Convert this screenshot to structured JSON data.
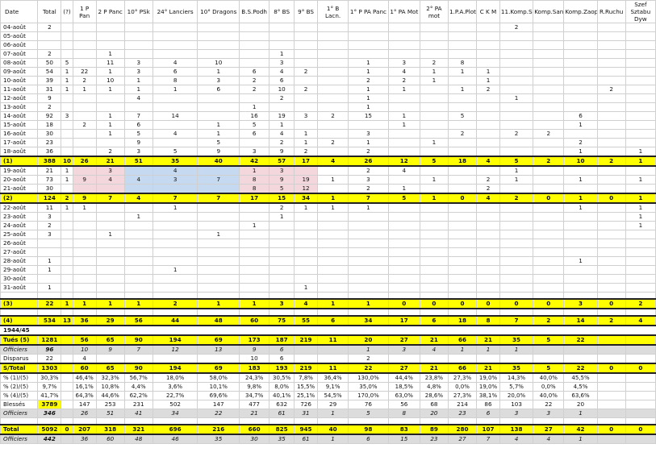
{
  "columns": [
    "Date",
    "Total",
    "(?)",
    "1 P Pan",
    "2 P Panc",
    "10° PSk",
    "24° Lanciers",
    "10° Dragons",
    "B.S.Podh",
    "8° BS",
    "9° BS",
    "1° B Lacn.",
    "1° P PA Panc",
    "1° PA Mot",
    "2° PA mot",
    "1.P.A.Plot.",
    "C K M",
    "11.Komp.Sap",
    "Komp.San",
    "Komp.Zaop.",
    "R.Ruchu",
    "Szef Sztabu Dyw"
  ],
  "rows": [
    {
      "type": "normal",
      "cells": [
        "04-août",
        "2",
        "",
        "",
        "",
        "",
        "",
        "",
        "",
        "",
        "",
        "",
        "",
        "",
        "",
        "",
        "",
        "2",
        "",
        "",
        "",
        ""
      ]
    },
    {
      "type": "normal",
      "cells": [
        "05-août",
        "",
        "",
        "",
        "",
        "",
        "",
        "",
        "",
        "",
        "",
        "",
        "",
        "",
        "",
        "",
        "",
        "",
        "",
        "",
        "",
        ""
      ]
    },
    {
      "type": "normal",
      "cells": [
        "06-août",
        "",
        "",
        "",
        "",
        "",
        "",
        "",
        "",
        "",
        "",
        "",
        "",
        "",
        "",
        "",
        "",
        "",
        "",
        "",
        "",
        ""
      ]
    },
    {
      "type": "normal",
      "cells": [
        "07-août",
        "2",
        "",
        "",
        "1",
        "",
        "",
        "",
        "",
        "1",
        "",
        "",
        "",
        "",
        "",
        "",
        "",
        "",
        "",
        "",
        "",
        ""
      ]
    },
    {
      "type": "normal",
      "cells": [
        "08-août",
        "50",
        "5",
        "",
        "11",
        "3",
        "4",
        "10",
        "",
        "3",
        "",
        "",
        "1",
        "3",
        "2",
        "8",
        "",
        "",
        "",
        "",
        "",
        ""
      ]
    },
    {
      "type": "normal",
      "cells": [
        "09-août",
        "54",
        "1",
        "22",
        "1",
        "3",
        "6",
        "1",
        "6",
        "4",
        "2",
        "",
        "1",
        "4",
        "1",
        "1",
        "1",
        "",
        "",
        "",
        "",
        ""
      ]
    },
    {
      "type": "normal",
      "cells": [
        "10-août",
        "39",
        "1",
        "2",
        "10",
        "1",
        "8",
        "3",
        "2",
        "6",
        "",
        "",
        "2",
        "2",
        "1",
        "",
        "1",
        "",
        "",
        "",
        "",
        ""
      ]
    },
    {
      "type": "normal",
      "cells": [
        "11-août",
        "31",
        "1",
        "1",
        "1",
        "1",
        "1",
        "6",
        "2",
        "10",
        "2",
        "",
        "1",
        "1",
        "",
        "1",
        "2",
        "",
        "",
        "",
        "2",
        ""
      ]
    },
    {
      "type": "normal",
      "cells": [
        "12-août",
        "9",
        "",
        "",
        "",
        "4",
        "",
        "",
        "",
        "2",
        "",
        "",
        "1",
        "",
        "",
        "",
        "",
        "1",
        "",
        "",
        "",
        ""
      ]
    },
    {
      "type": "normal",
      "cells": [
        "13-août",
        "2",
        "",
        "",
        "",
        "",
        "",
        "",
        "1",
        "",
        "",
        "",
        "1",
        "",
        "",
        "",
        "",
        "",
        "",
        "",
        "",
        ""
      ]
    },
    {
      "type": "normal",
      "cells": [
        "14-août",
        "92",
        "3",
        "",
        "1",
        "7",
        "14",
        "",
        "16",
        "19",
        "3",
        "2",
        "15",
        "1",
        "",
        "5",
        "",
        "",
        "",
        "6",
        "",
        ""
      ]
    },
    {
      "type": "normal",
      "cells": [
        "15-août",
        "18",
        "",
        "2",
        "1",
        "6",
        "",
        "1",
        "5",
        "1",
        "",
        "",
        "",
        "1",
        "",
        "",
        "",
        "",
        "",
        "1",
        "",
        ""
      ]
    },
    {
      "type": "normal",
      "cells": [
        "16-août",
        "30",
        "",
        "",
        "1",
        "5",
        "4",
        "1",
        "6",
        "4",
        "1",
        "",
        "3",
        "",
        "",
        "2",
        "",
        "2",
        "2",
        "",
        "",
        ""
      ]
    },
    {
      "type": "normal",
      "cells": [
        "17-août",
        "23",
        "",
        "",
        "",
        "9",
        "",
        "5",
        "",
        "2",
        "1",
        "2",
        "1",
        "",
        "1",
        "",
        "",
        "",
        "",
        "2",
        "",
        ""
      ]
    },
    {
      "type": "normal",
      "cells": [
        "18-août",
        "36",
        "",
        "",
        "2",
        "3",
        "5",
        "9",
        "3",
        "9",
        "2",
        "",
        "2",
        "",
        "",
        "",
        "",
        "",
        "",
        "1",
        "",
        "1"
      ]
    },
    {
      "type": "yellow",
      "cells": [
        "(1)",
        "388",
        "10",
        "26",
        "21",
        "51",
        "35",
        "40",
        "42",
        "57",
        "17",
        "4",
        "26",
        "12",
        "5",
        "18",
        "4",
        "5",
        "2",
        "10",
        "2",
        "1"
      ]
    },
    {
      "type": "hl",
      "cells": [
        "19-août",
        "21",
        "1",
        "",
        "3",
        "",
        "4",
        "",
        "1",
        "3",
        "",
        "",
        "2",
        "4",
        "",
        "",
        "",
        "1",
        "",
        "",
        "",
        ""
      ]
    },
    {
      "type": "hl",
      "cells": [
        "20-août",
        "73",
        "1",
        "9",
        "4",
        "4",
        "3",
        "7",
        "8",
        "9",
        "19",
        "1",
        "3",
        "",
        "1",
        "",
        "2",
        "1",
        "",
        "1",
        "",
        "1"
      ]
    },
    {
      "type": "hl",
      "cells": [
        "21-août",
        "30",
        "",
        "",
        "",
        "",
        "",
        "",
        "8",
        "5",
        "12",
        "",
        "2",
        "1",
        "",
        "",
        "2",
        "",
        "",
        "",
        "",
        ""
      ]
    },
    {
      "type": "yellow",
      "cells": [
        "(2)",
        "124",
        "2",
        "9",
        "7",
        "4",
        "7",
        "7",
        "17",
        "15",
        "34",
        "1",
        "7",
        "5",
        "1",
        "0",
        "4",
        "2",
        "0",
        "1",
        "0",
        "1"
      ]
    },
    {
      "type": "normal",
      "cells": [
        "22-août",
        "11",
        "1",
        "1",
        "",
        "",
        "1",
        "",
        "",
        "2",
        "1",
        "1",
        "1",
        "",
        "",
        "",
        "",
        "",
        "",
        "1",
        "",
        "1"
      ]
    },
    {
      "type": "normal",
      "cells": [
        "23-août",
        "3",
        "",
        "",
        "",
        "1",
        "",
        "",
        "",
        "1",
        "",
        "",
        "",
        "",
        "",
        "",
        "",
        "",
        "",
        "",
        "",
        "1"
      ]
    },
    {
      "type": "normal",
      "cells": [
        "24-août",
        "2",
        "",
        "",
        "",
        "",
        "",
        "",
        "1",
        "",
        "",
        "",
        "",
        "",
        "",
        "",
        "",
        "",
        "",
        "",
        "",
        "1"
      ]
    },
    {
      "type": "normal",
      "cells": [
        "25-août",
        "3",
        "",
        "",
        "1",
        "",
        "",
        "1",
        "",
        "",
        "",
        "",
        "",
        "",
        "",
        "",
        "",
        "",
        "",
        "",
        "",
        ""
      ]
    },
    {
      "type": "normal",
      "cells": [
        "26-août",
        "",
        "",
        "",
        "",
        "",
        "",
        "",
        "",
        "",
        "",
        "",
        "",
        "",
        "",
        "",
        "",
        "",
        "",
        "",
        "",
        ""
      ]
    },
    {
      "type": "normal",
      "cells": [
        "27-août",
        "",
        "",
        "",
        "",
        "",
        "",
        "",
        "",
        "",
        "",
        "",
        "",
        "",
        "",
        "",
        "",
        "",
        "",
        "",
        "",
        ""
      ]
    },
    {
      "type": "normal",
      "cells": [
        "28-août",
        "1",
        "",
        "",
        "",
        "",
        "",
        "",
        "",
        "",
        "",
        "",
        "",
        "",
        "",
        "",
        "",
        "",
        "",
        "1",
        "",
        ""
      ]
    },
    {
      "type": "normal",
      "cells": [
        "29-août",
        "1",
        "",
        "",
        "",
        "",
        "1",
        "",
        "",
        "",
        "",
        "",
        "",
        "",
        "",
        "",
        "",
        "",
        "",
        "",
        "",
        ""
      ]
    },
    {
      "type": "normal",
      "cells": [
        "30-août",
        "",
        "",
        "",
        "",
        "",
        "",
        "",
        "",
        "",
        "",
        "",
        "",
        "",
        "",
        "",
        "",
        "",
        "",
        "",
        "",
        ""
      ]
    },
    {
      "type": "normal",
      "cells": [
        "31-août",
        "1",
        "",
        "",
        "",
        "",
        "",
        "",
        "",
        "",
        "1",
        "",
        "",
        "",
        "",
        "",
        "",
        "",
        "",
        "",
        "",
        ""
      ]
    },
    {
      "type": "gap",
      "cells": [
        "",
        "",
        "",
        "",
        "",
        "",
        "",
        "",
        "",
        "",
        "",
        "",
        "",
        "",
        "",
        "",
        "",
        "",
        "",
        "",
        "",
        ""
      ]
    },
    {
      "type": "yellow",
      "cells": [
        "(3)",
        "22",
        "1",
        "1",
        "1",
        "1",
        "2",
        "1",
        "1",
        "3",
        "4",
        "1",
        "1",
        "0",
        "0",
        "0",
        "0",
        "0",
        "0",
        "3",
        "0",
        "2"
      ]
    },
    {
      "type": "gap",
      "cells": [
        "",
        "",
        "",
        "",
        "",
        "",
        "",
        "",
        "",
        "",
        "",
        "",
        "",
        "",
        "",
        "",
        "",
        "",
        "",
        "",
        "",
        ""
      ]
    },
    {
      "type": "yellow",
      "cells": [
        "(4)",
        "534",
        "13",
        "36",
        "29",
        "56",
        "44",
        "48",
        "60",
        "75",
        "55",
        "6",
        "34",
        "17",
        "6",
        "18",
        "8",
        "7",
        "2",
        "14",
        "2",
        "4"
      ]
    },
    {
      "type": "year",
      "cells": [
        "1944/45",
        "",
        "",
        "",
        "",
        "",
        "",
        "",
        "",
        "",
        "",
        "",
        "",
        "",
        "",
        "",
        "",
        "",
        "",
        "",
        "",
        ""
      ]
    },
    {
      "type": "yellow",
      "cells": [
        "Tués (5)",
        "1281",
        "",
        "56",
        "65",
        "90",
        "194",
        "69",
        "173",
        "187",
        "219",
        "11",
        "20",
        "27",
        "21",
        "66",
        "21",
        "35",
        "5",
        "22",
        "",
        ""
      ]
    },
    {
      "type": "gray",
      "cells": [
        "Officiers",
        "96",
        "",
        "10",
        "9",
        "7",
        "12",
        "13",
        "9",
        "6",
        "",
        "",
        "1",
        "3",
        "4",
        "1",
        "1",
        "1",
        "",
        "",
        "",
        ""
      ]
    },
    {
      "type": "normal",
      "cells": [
        "Disparus",
        "22",
        "",
        "4",
        "",
        "",
        "",
        "",
        "10",
        "6",
        "",
        "",
        "2",
        "",
        "",
        "",
        "",
        "",
        "",
        "",
        "",
        ""
      ]
    },
    {
      "type": "yellow",
      "cells": [
        "S/Total",
        "1303",
        "",
        "60",
        "65",
        "90",
        "194",
        "69",
        "183",
        "193",
        "219",
        "11",
        "22",
        "27",
        "21",
        "66",
        "21",
        "35",
        "5",
        "22",
        "0",
        "0"
      ]
    },
    {
      "type": "pct",
      "cells": [
        "% (1)/(5)",
        "30,3%",
        "",
        "46,4%",
        "32,3%",
        "56,7%",
        "18,0%",
        "58,0%",
        "24,3%",
        "30,5%",
        "7,8%",
        "36,4%",
        "130,0%",
        "44,4%",
        "23,8%",
        "27,3%",
        "19,0%",
        "14,3%",
        "40,0%",
        "45,5%",
        "",
        ""
      ]
    },
    {
      "type": "pct",
      "cells": [
        "% (2)/(5)",
        "9,7%",
        "",
        "16,1%",
        "10,8%",
        "4,4%",
        "3,6%",
        "10,1%",
        "9,8%",
        "8,0%",
        "15,5%",
        "9,1%",
        "35,0%",
        "18,5%",
        "4,8%",
        "0,0%",
        "19,0%",
        "5,7%",
        "0,0%",
        "4,5%",
        "",
        ""
      ]
    },
    {
      "type": "pct",
      "cells": [
        "% (4)/(5)",
        "41,7%",
        "",
        "64,3%",
        "44,6%",
        "62,2%",
        "22,7%",
        "69,6%",
        "34,7%",
        "40,1%",
        "25,1%",
        "54,5%",
        "170,0%",
        "63,0%",
        "28,6%",
        "27,3%",
        "38,1%",
        "20,0%",
        "40,0%",
        "63,6%",
        "",
        ""
      ]
    },
    {
      "type": "blesses",
      "cells": [
        "Blessés",
        "3789",
        "",
        "147",
        "253",
        "231",
        "502",
        "147",
        "477",
        "632",
        "726",
        "29",
        "76",
        "56",
        "68",
        "214",
        "86",
        "103",
        "22",
        "20",
        "",
        ""
      ]
    },
    {
      "type": "gray",
      "cells": [
        "Officiers",
        "346",
        "",
        "26",
        "51",
        "41",
        "34",
        "22",
        "21",
        "61",
        "31",
        "1",
        "5",
        "8",
        "20",
        "23",
        "6",
        "3",
        "3",
        "1",
        "",
        ""
      ]
    },
    {
      "type": "gap",
      "cells": [
        "",
        "",
        "",
        "",
        "",
        "",
        "",
        "",
        "",
        "",
        "",
        "",
        "",
        "",
        "",
        "",
        "",
        "",
        "",
        "",
        "",
        ""
      ]
    },
    {
      "type": "yellow",
      "cells": [
        "Total",
        "5092",
        "0",
        "207",
        "318",
        "321",
        "696",
        "216",
        "660",
        "825",
        "945",
        "40",
        "98",
        "83",
        "89",
        "280",
        "107",
        "138",
        "27",
        "42",
        "0",
        "0"
      ]
    },
    {
      "type": "gray",
      "cells": [
        "Officiers",
        "442",
        "",
        "36",
        "60",
        "48",
        "46",
        "35",
        "30",
        "35",
        "61",
        "1",
        "6",
        "15",
        "23",
        "27",
        "7",
        "4",
        "4",
        "1",
        "",
        ""
      ]
    }
  ]
}
